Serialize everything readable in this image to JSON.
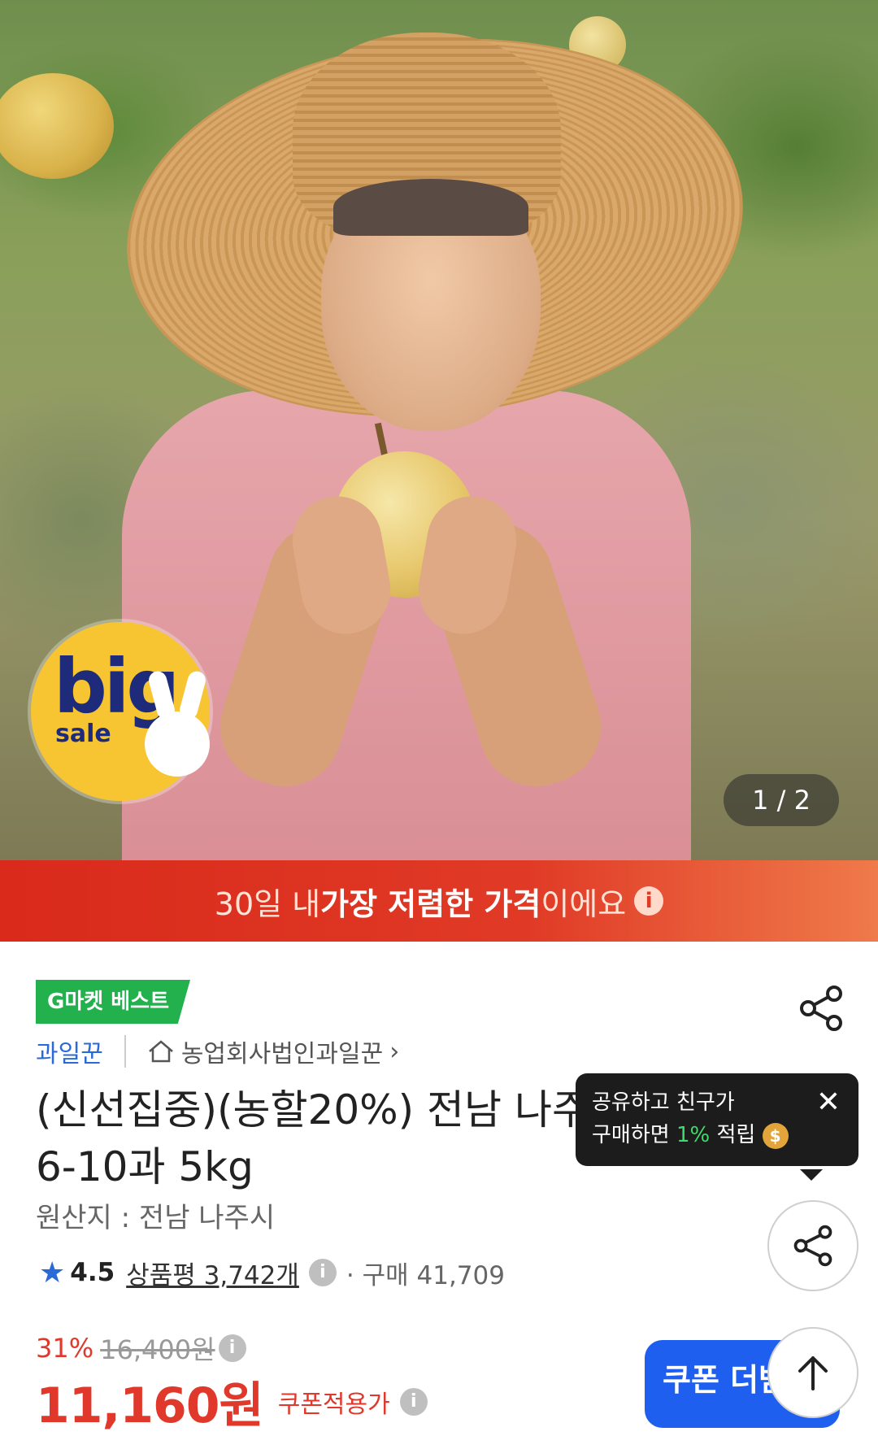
{
  "hero": {
    "badge_big": "big",
    "badge_sale": "sale",
    "counter": "1 / 2"
  },
  "promo": {
    "pre": "30일 내 ",
    "bold": "가장 저렴한 가격",
    "post": "이에요"
  },
  "product": {
    "best_badge": "G마켓 베스트",
    "seller": "과일꾼",
    "shop": "농업회사법인과일꾼",
    "title_line1": "(신선집중)(농할20%) 전남 나주",
    "title_line2": "6-10과 5kg",
    "origin": "원산지 : 전남 나주시",
    "rating": "4.5",
    "reviews": "상품평 3,742개",
    "buy_count": "· 구매 41,709",
    "discount": "31%",
    "original_price": "16,400원",
    "price": "11,160원",
    "coupon_price_label": "쿠폰적용가",
    "coupon_button": "쿠폰 더받"
  },
  "tooltip": {
    "line1": "공유하고 친구가",
    "line2_pre": "구매하면 ",
    "line2_green": "1%",
    "line2_post": " 적립"
  },
  "colors": {
    "accent_red": "#e0392b",
    "accent_blue": "#1f5ff0",
    "best_green": "#22b14c",
    "promo_gradient": [
      "#d92a1b",
      "#ef7a4a"
    ]
  }
}
